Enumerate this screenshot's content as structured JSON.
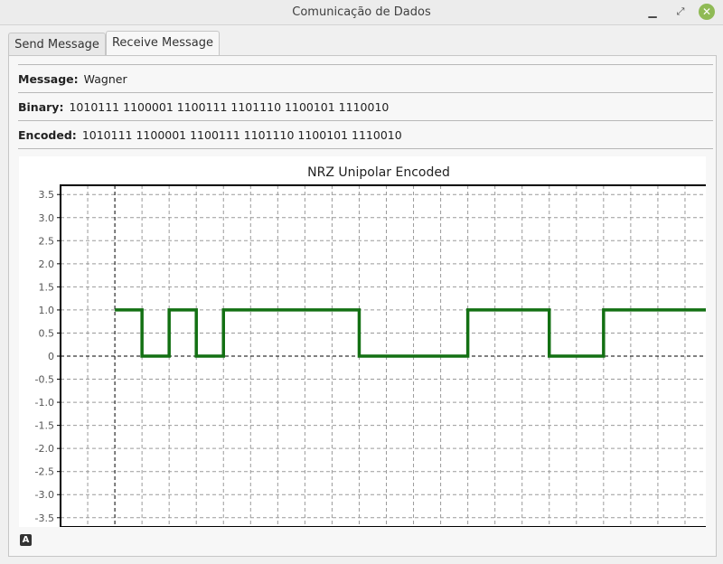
{
  "window": {
    "title": "Comunicação de Dados",
    "minimize_glyph": "▁",
    "maximize_glyph": "⤢",
    "close_glyph": "✕"
  },
  "tabs": [
    {
      "label": "Send Message"
    },
    {
      "label": "Receive Message"
    }
  ],
  "fields": {
    "message_label": "Message:",
    "message_value": "Wagner",
    "binary_label": "Binary:",
    "binary_value": "1010111 1100001 1100111 1101110 1100101 1110010",
    "encoded_label": "Encoded:",
    "encoded_value": "1010111 1100001 1100111 1101110 1100101 1110010"
  },
  "footer": {
    "badge_glyph": "A"
  },
  "chart_data": {
    "type": "line",
    "title": "NRZ Unipolar Encoded",
    "xlabel": "",
    "ylabel": "",
    "xlim": [
      -2,
      22
    ],
    "ylim": [
      -3.7,
      3.7
    ],
    "xticks": [
      -1,
      0,
      1,
      2,
      3,
      4,
      5,
      6,
      7,
      8,
      9,
      10,
      11,
      12,
      13,
      14,
      15,
      16,
      17,
      18,
      19,
      20,
      21
    ],
    "yticks": [
      3.5,
      3.0,
      2.5,
      2.0,
      1.5,
      1.0,
      0.5,
      0,
      -0.5,
      -1.0,
      -1.5,
      -2.0,
      -2.5,
      -3.0,
      -3.5
    ],
    "ytick_labels": [
      "3.5",
      "3.0",
      "2.5",
      "2.0",
      "1.5",
      "1.0",
      "0.5",
      "0",
      "-0.5",
      "-1.0",
      "-1.5",
      "-2.0",
      "-2.5",
      "-3.0",
      "-3.5"
    ],
    "grid": true,
    "series": [
      {
        "color": "#137013",
        "x": [
          0,
          1,
          1,
          2,
          2,
          3,
          3,
          4,
          4,
          9,
          9,
          13,
          13,
          16,
          16,
          18,
          18,
          22
        ],
        "y": [
          1,
          1,
          0,
          0,
          1,
          1,
          0,
          0,
          1,
          1,
          0,
          0,
          1,
          1,
          0,
          0,
          1,
          1
        ]
      }
    ]
  }
}
